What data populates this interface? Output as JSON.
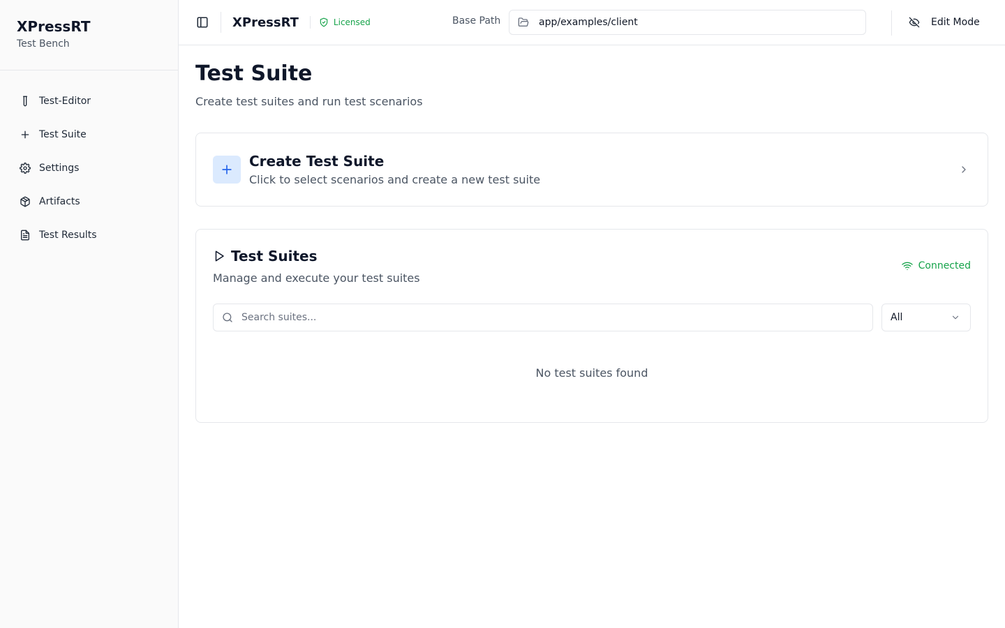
{
  "sidebar": {
    "app_name": "XPressRT",
    "app_subtitle": "Test Bench",
    "items": [
      {
        "label": "Test-Editor",
        "icon": "test-tube-icon"
      },
      {
        "label": "Test Suite",
        "icon": "plus-icon"
      },
      {
        "label": "Settings",
        "icon": "gear-icon"
      },
      {
        "label": "Artifacts",
        "icon": "package-icon"
      },
      {
        "label": "Test Results",
        "icon": "file-text-icon"
      }
    ]
  },
  "header": {
    "title": "XPressRT",
    "license_label": "Licensed",
    "base_path_label": "Base Path",
    "base_path_value": "app/examples/client",
    "edit_mode_label": "Edit Mode"
  },
  "main": {
    "title": "Test Suite",
    "description": "Create test suites and run test scenarios",
    "create_card": {
      "title": "Create Test Suite",
      "description": "Click to select scenarios and create a new test suite"
    },
    "suites_card": {
      "title": "Test Suites",
      "description": "Manage and execute your test suites",
      "status": "Connected",
      "search_placeholder": "Search suites...",
      "filter_value": "All",
      "empty_text": "No test suites found"
    }
  },
  "colors": {
    "accent": "#2563eb",
    "success": "#16a34a",
    "border": "#e5e7eb"
  }
}
